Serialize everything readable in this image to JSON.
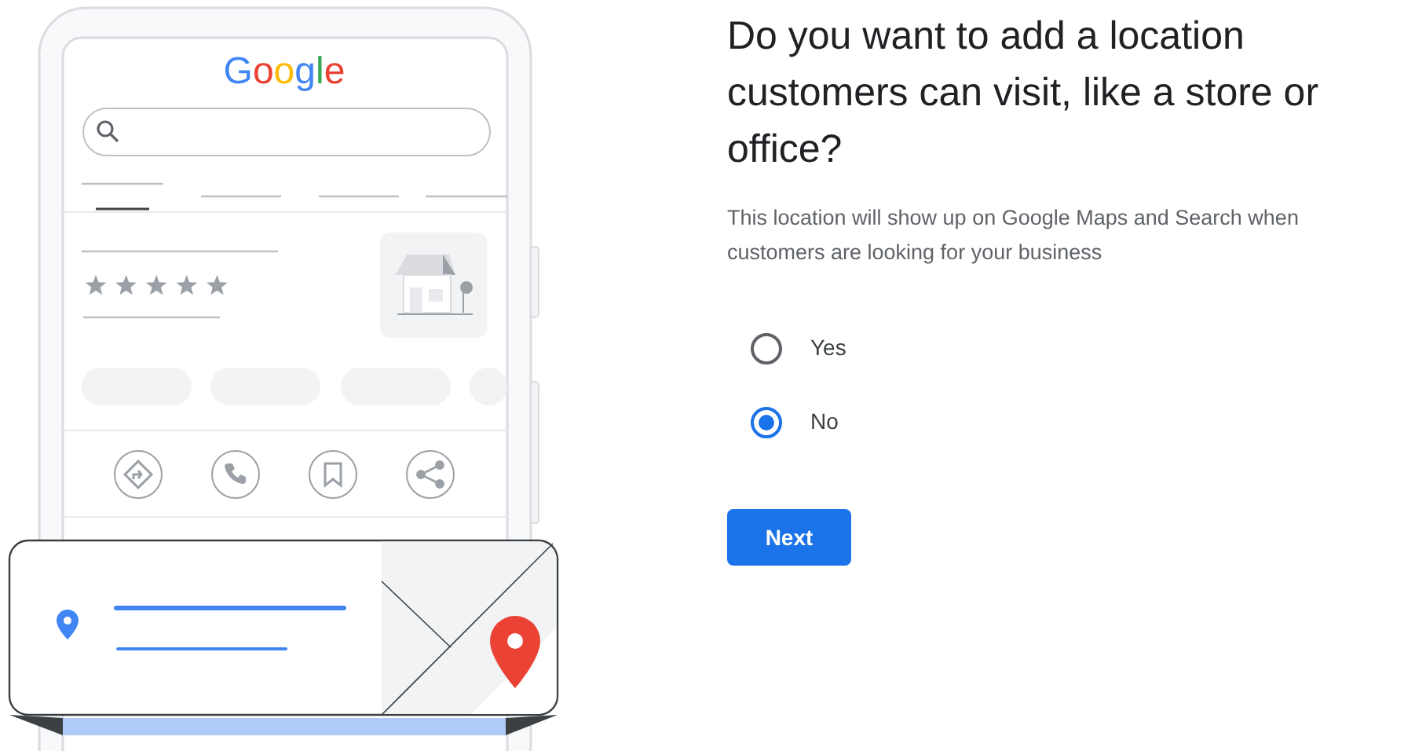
{
  "illustration": {
    "logo": "Google",
    "stars": 5
  },
  "heading": "Do you want to add a location customers can visit, like a store or office?",
  "description": "This location will show up on Google Maps and Search when customers are looking for your business",
  "options": [
    {
      "label": "Yes",
      "selected": false
    },
    {
      "label": "No",
      "selected": true
    }
  ],
  "next_button": "Next"
}
